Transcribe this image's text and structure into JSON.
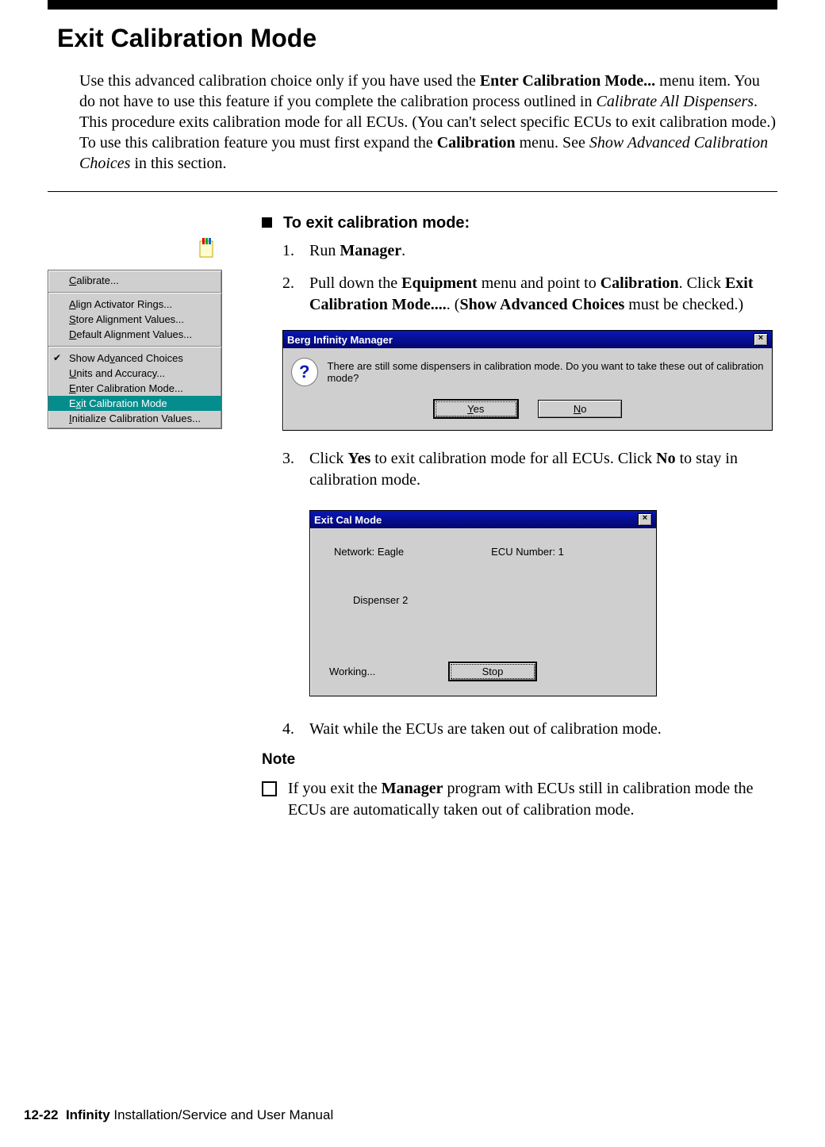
{
  "page": {
    "title": "Exit Calibration Mode",
    "footer_page": "12-22",
    "footer_bold": "Infinity",
    "footer_rest": " Installation/Service and User Manual"
  },
  "intro": {
    "p1a": "Use this advanced calibration choice only if you have used the ",
    "p1b": "Enter Calibration Mode...",
    "p1c": " menu item. You do not have to use this feature if you complete the calibration process outlined in ",
    "p1d": "Calibrate All Dispensers",
    "p1e": ". This procedure exits calibration mode for all ECUs. (You can't select specific ECUs to exit calibration mode.) To use this calibration feature you must first expand the ",
    "p1f": "Calibration",
    "p1g": " menu. See ",
    "p1h": "Show Advanced Calibration Choices",
    "p1i": " in this section."
  },
  "menu": {
    "items": [
      {
        "pre": "C",
        "rest": "alibrate..."
      },
      {
        "pre": "A",
        "rest": "lign Activator Rings..."
      },
      {
        "pre": "S",
        "rest": "tore Alignment Values..."
      },
      {
        "pre": "D",
        "rest": "efault Alignment Values..."
      },
      {
        "pre": "Show Ad",
        "mid": "v",
        "rest": "anced Choices",
        "checked": true
      },
      {
        "pre": "U",
        "rest": "nits and Accuracy..."
      },
      {
        "pre": "E",
        "rest": "nter Calibration Mode..."
      },
      {
        "pre": "E",
        "mid": "x",
        "rest": "it Calibration Mode",
        "selected": true
      },
      {
        "pre": "I",
        "rest": "nitialize Calibration Values..."
      }
    ]
  },
  "proc": {
    "heading": "To exit calibration mode:",
    "s1_num": "1.",
    "s1a": "Run ",
    "s1b": "Manager",
    "s1c": ".",
    "s2_num": "2.",
    "s2a": "Pull down the ",
    "s2b": "Equipment",
    "s2c": " menu and point to ",
    "s2d": "Calibration",
    "s2e": ". Click ",
    "s2f": "Exit Calibration Mode....",
    "s2g": ". (",
    "s2h": "Show Advanced Choices",
    "s2i": " must be checked.)",
    "s3_num": "3.",
    "s3a": "Click ",
    "s3b": "Yes",
    "s3c": " to exit calibration mode for all ECUs. Click ",
    "s3d": "No",
    "s3e": " to stay in calibration mode.",
    "s4_num": "4.",
    "s4": "Wait while the ECUs are taken out of calibration mode."
  },
  "dlg1": {
    "title": "Berg Infinity Manager",
    "msg": "There are still some dispensers in calibration mode. Do you want to take these out of calibration mode?",
    "yes_u": "Y",
    "yes_r": "es",
    "no_u": "N",
    "no_r": "o"
  },
  "dlg2": {
    "title": "Exit Cal Mode",
    "net": "Network: Eagle",
    "ecu": "ECU Number: 1",
    "disp": "Dispenser 2",
    "work": "Working...",
    "stop": "Stop"
  },
  "note": {
    "head": "Note",
    "a": "If you exit the ",
    "b": "Manager",
    "c": " program with ECUs still in calibration mode the ECUs are automatically taken out of calibration mode."
  }
}
